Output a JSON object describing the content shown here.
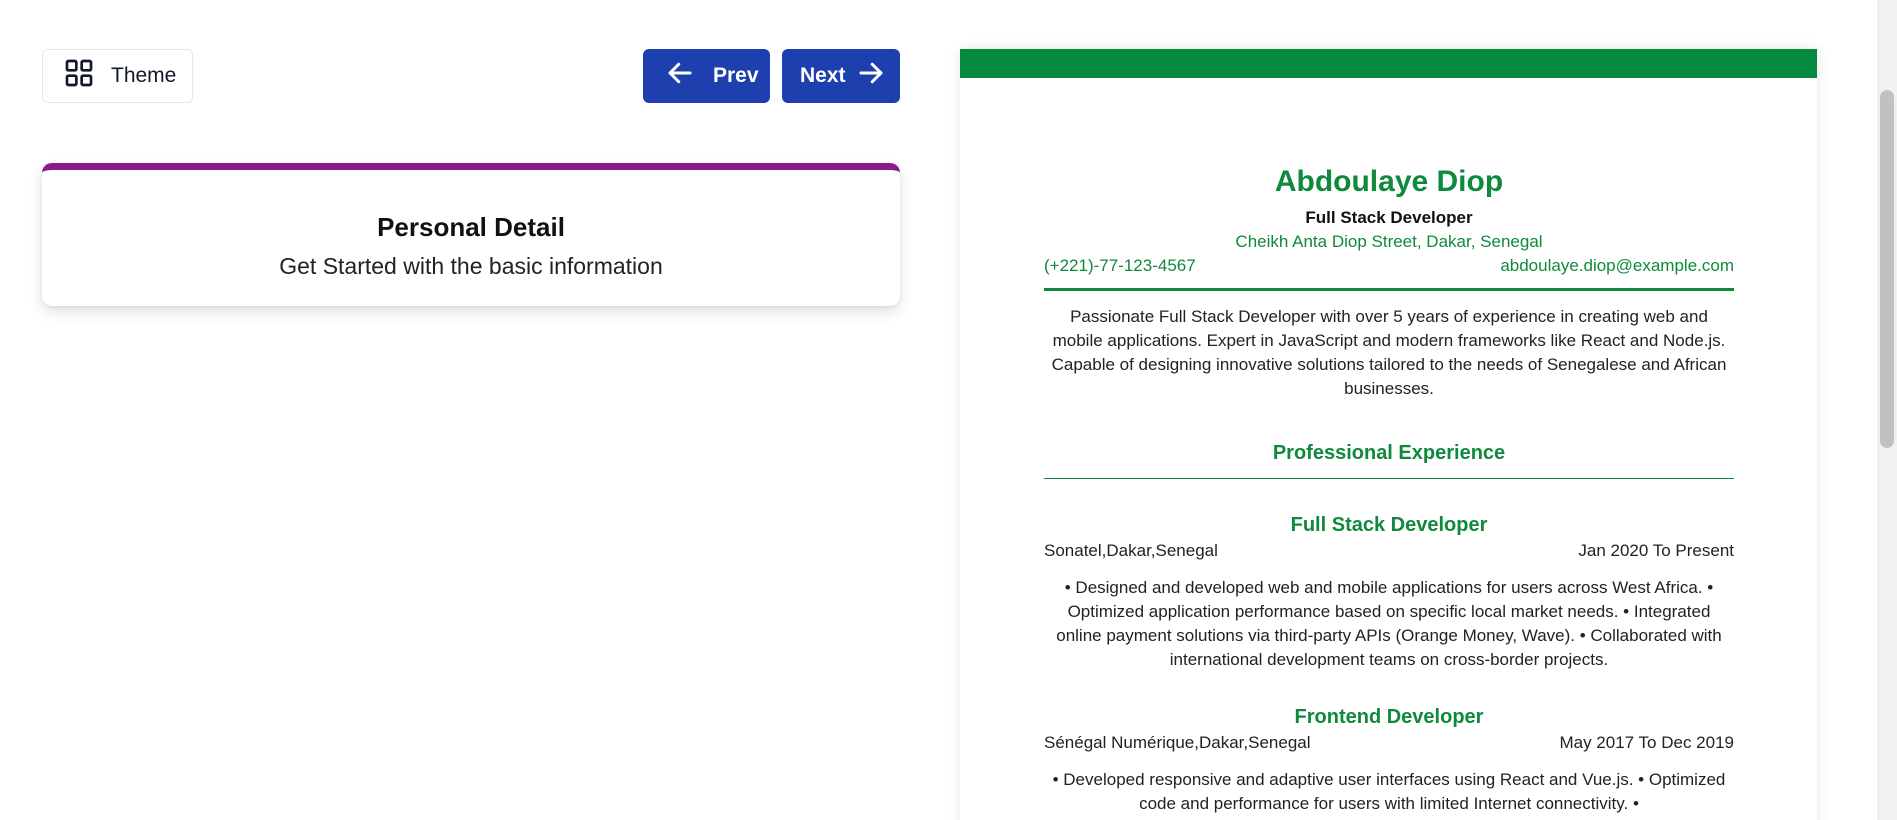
{
  "toolbar": {
    "theme_label": "Theme",
    "prev_label": "Prev",
    "next_label": "Next"
  },
  "form": {
    "title": "Personal Detail",
    "subtitle": "Get Started with the basic information"
  },
  "colors": {
    "accent": "#1e40af",
    "theme_color": "#0f8a3c",
    "card_border": "#8b1a8b"
  },
  "resume": {
    "name": "Abdoulaye Diop",
    "job_title": "Full Stack Developer",
    "address": "Cheikh Anta Diop Street, Dakar, Senegal",
    "phone": "(+221)-77-123-4567",
    "email": "abdoulaye.diop@example.com",
    "summary": "Passionate Full Stack Developer with over 5 years of experience in creating web and mobile applications. Expert in JavaScript and modern frameworks like React and Node.js. Capable of designing innovative solutions tailored to the needs of Senegalese and African businesses.",
    "experience_heading": "Professional Experience",
    "experience": [
      {
        "title": "Full Stack Developer",
        "company": "Sonatel,Dakar,Senegal",
        "dates": "Jan 2020 To Present",
        "description": "• Designed and developed web and mobile applications for users across West Africa. • Optimized application performance based on specific local market needs. • Integrated online payment solutions via third-party APIs (Orange Money, Wave). • Collaborated with international development teams on cross-border projects."
      },
      {
        "title": "Frontend Developer",
        "company": "Sénégal Numérique,Dakar,Senegal",
        "dates": "May 2017 To Dec 2019",
        "description": "• Developed responsive and adaptive user interfaces using React and Vue.js. • Optimized code and performance for users with limited Internet connectivity. •"
      }
    ]
  }
}
